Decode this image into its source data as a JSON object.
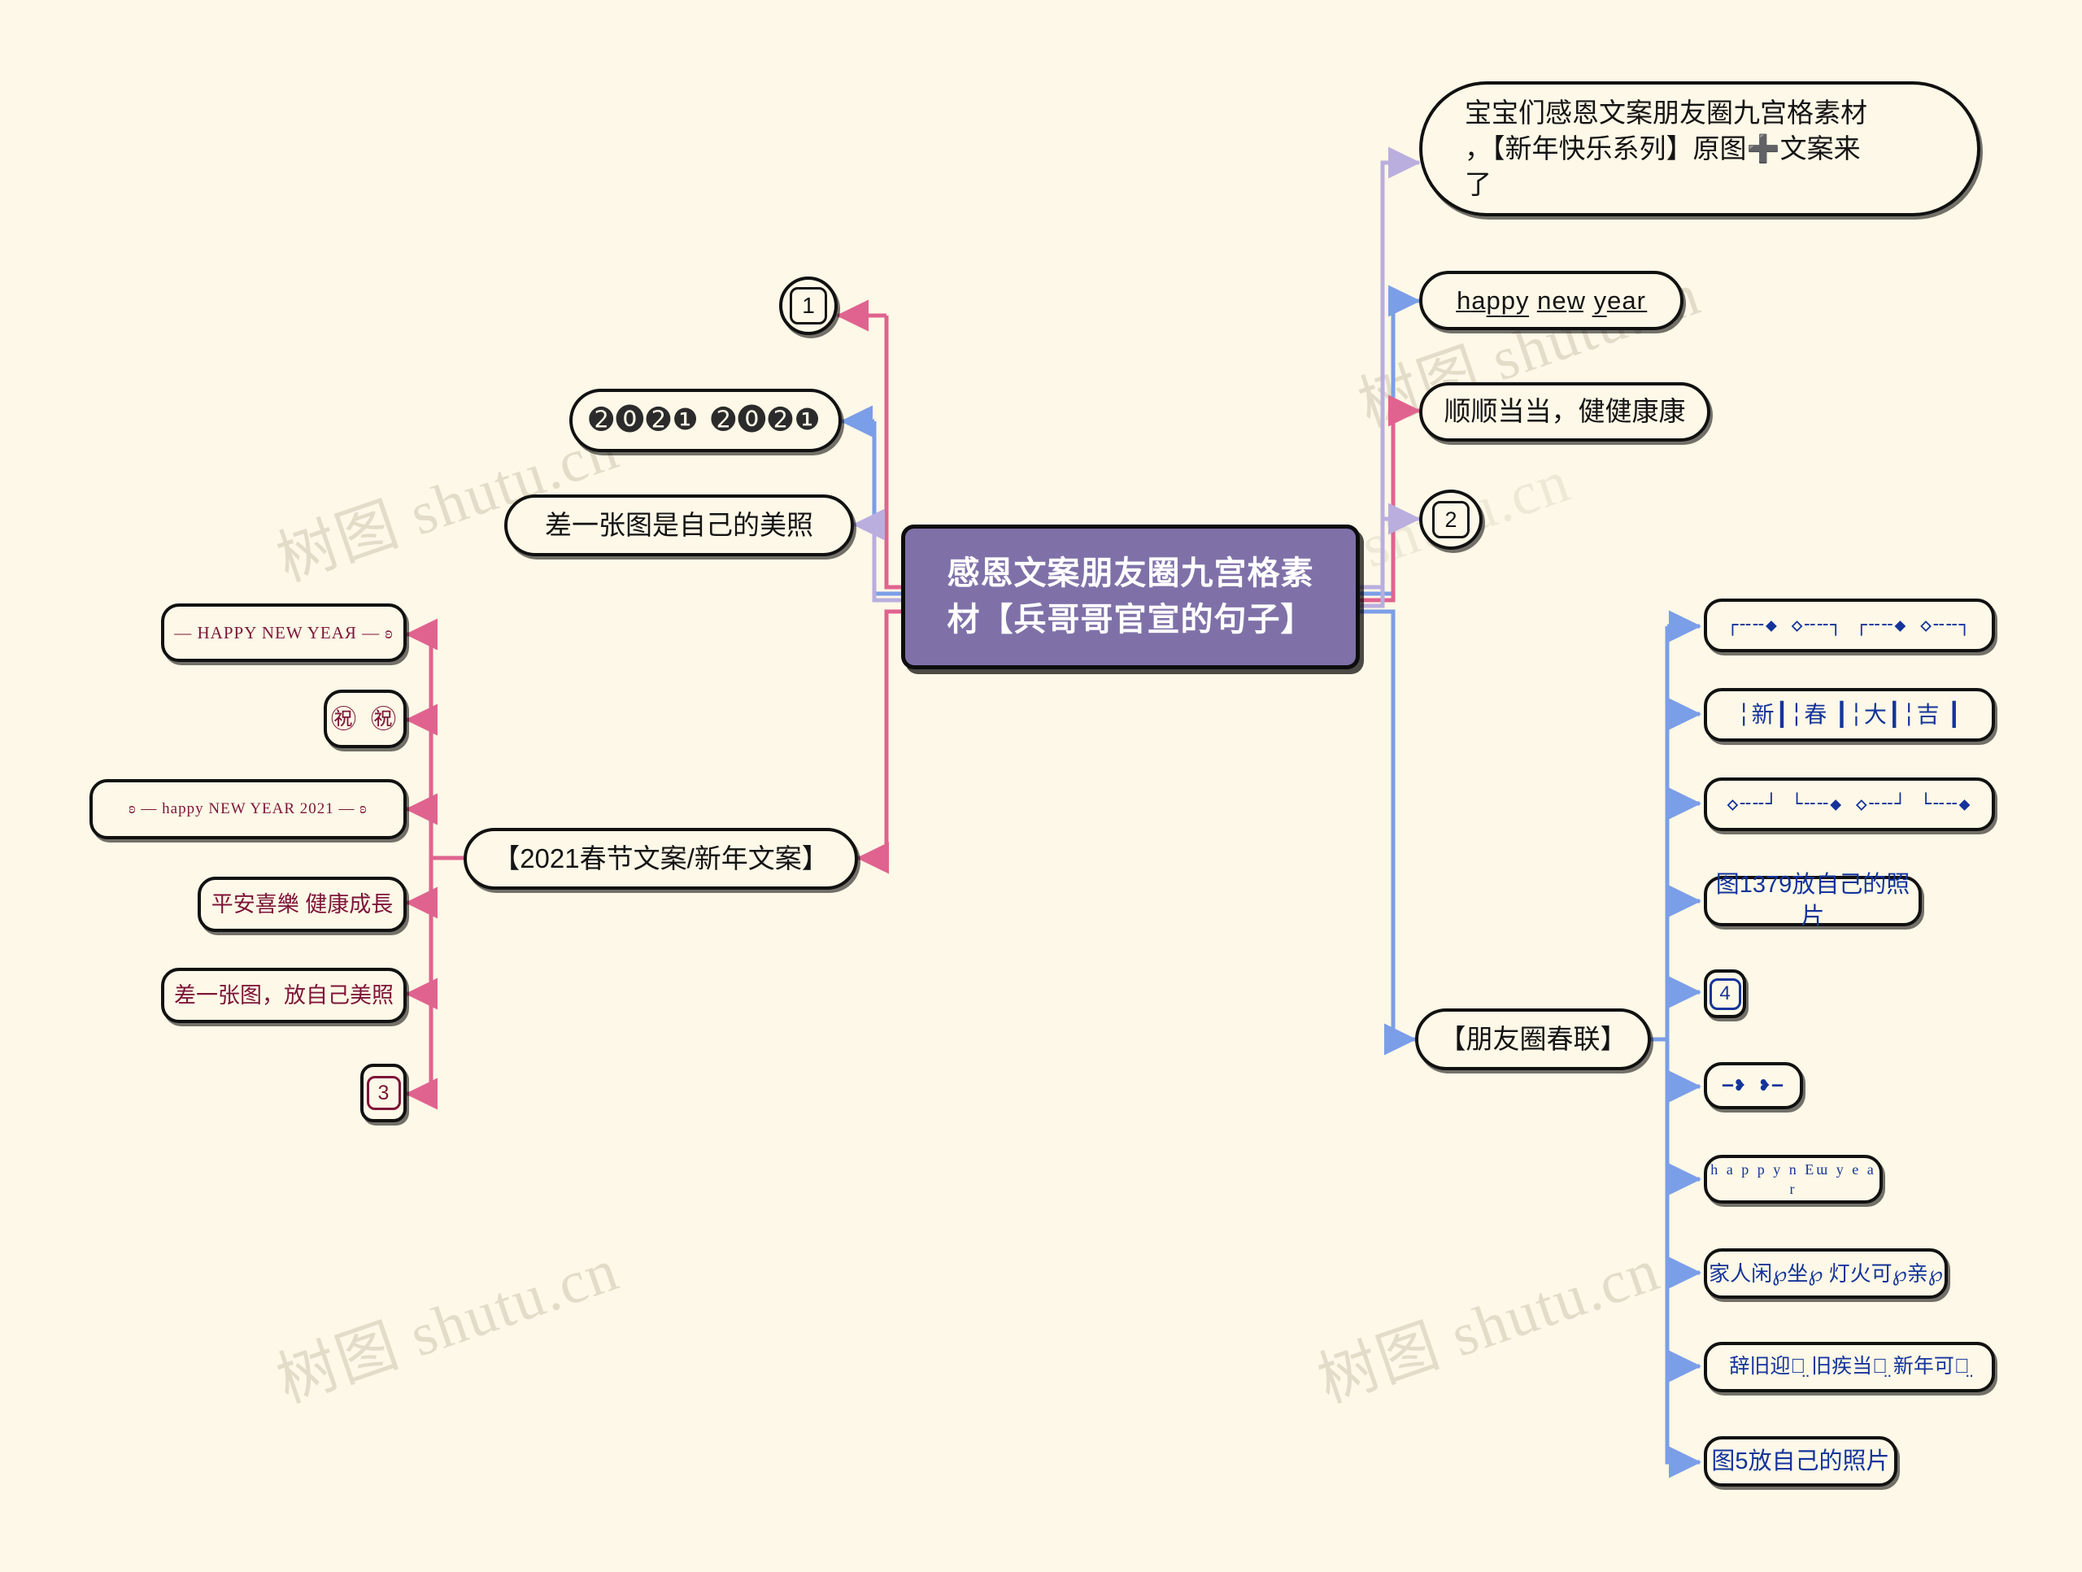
{
  "meta": {
    "background": "#fdf8e7",
    "root_fill": "#7f71a8",
    "link_colors": {
      "pink": "#e0638f",
      "blue": "#7b9ee8",
      "lavender": "#b9aede",
      "maroon": "#7d1538",
      "navy": "#14349b"
    }
  },
  "watermarks": [
    {
      "text": "树图 shutu.cn"
    },
    {
      "text": "树图 shutu.cn"
    },
    {
      "text": "树图 shutu.cn"
    },
    {
      "text": "树图 shutu.cn"
    },
    {
      "text": "树图 shutu.cn"
    }
  ],
  "root": {
    "label": "感恩文案朋友圈九宫格素材【兵哥哥官宣的句子】",
    "line1": "感恩文案朋友圈九宫格素",
    "line2": "材【兵哥哥官宣的句子】"
  },
  "branches": {
    "left_top": {
      "name": "left-upper-branch",
      "nodes": [
        {
          "id": "n-circle-1",
          "label": "1",
          "kind": "circled-number",
          "link": "pink"
        },
        {
          "id": "n-2021",
          "label": "➋⓿➋❶ ➋⓿➋❶",
          "kind": "negative-circled-digits",
          "link": "blue"
        },
        {
          "id": "n-meizhao",
          "label": "差一张图是自己的美照",
          "kind": "text",
          "link": "lavender"
        }
      ]
    },
    "left_bottom": {
      "name": "left-lower-branch",
      "parent": {
        "id": "n-2021-chunjie",
        "label": "【2021春节文案/新年文案】",
        "link": "pink"
      },
      "nodes": [
        {
          "id": "n-hny-1",
          "label": "— HAPPY NEW YEAЯ — ʚ",
          "kind": "decorative",
          "link": "pink"
        },
        {
          "id": "n-zhu",
          "label": "㊗ ㊗",
          "kind": "decorative",
          "link": "pink"
        },
        {
          "id": "n-hny-2021",
          "label": "ʚ — happy NEW YEAR 2021 — ʚ",
          "kind": "decorative",
          "link": "pink"
        },
        {
          "id": "n-pingan",
          "label": "平安喜樂 健康成長",
          "kind": "text",
          "link": "pink"
        },
        {
          "id": "n-chayizhang",
          "label": "差一张图，放自己美照",
          "kind": "text",
          "link": "pink"
        },
        {
          "id": "n-box-3",
          "label": "3",
          "kind": "boxed-number",
          "link": "pink"
        }
      ]
    },
    "right_top": {
      "name": "right-upper-branch",
      "nodes": [
        {
          "id": "n-baobao",
          "label": "宝宝们感恩文案朋友圈九宫格素材，【新年快乐系列】原图➕文案来了",
          "line1": "宝宝们感恩文案朋友圈九宫格素材",
          "line2": "，【新年快乐系列】原图➕文案来",
          "line3": "了",
          "kind": "text",
          "link": "lavender"
        },
        {
          "id": "n-happy-new-year",
          "label": "h̲a̲p̲p̲y̲ n̲e̲w̲ y̲e̲a̲r̲",
          "kind": "decorative",
          "link": "blue"
        },
        {
          "id": "n-shunshun",
          "label": "顺顺当当，健健康康",
          "kind": "text",
          "link": "pink"
        },
        {
          "id": "n-box-2",
          "label": "2",
          "kind": "boxed-number",
          "link": "lavender"
        }
      ]
    },
    "right_bottom": {
      "name": "right-lower-branch",
      "parent": {
        "id": "n-chunlian",
        "label": "【朋友圈春联】",
        "link": "blue"
      },
      "nodes": [
        {
          "id": "n-deco-1",
          "label": "┌╌╌◆ ◇╌╌┐ ┌╌╌◆ ◇╌╌┐",
          "kind": "decorative",
          "link": "blue"
        },
        {
          "id": "n-xinchundaji",
          "label": "╎新┃╎春 ┃╎大┃╎吉 ┃",
          "kind": "decorative",
          "link": "blue"
        },
        {
          "id": "n-deco-2",
          "label": "◇╌╌┘ └╌╌◆ ◇╌╌┘ └╌╌◆",
          "kind": "decorative",
          "link": "blue"
        },
        {
          "id": "n-tu1379",
          "label": "图1379放自己的照片",
          "kind": "text",
          "link": "blue"
        },
        {
          "id": "n-box-4",
          "label": "4",
          "kind": "boxed-number",
          "link": "blue"
        },
        {
          "id": "n-hearts",
          "label": "—❥ ❥—",
          "kind": "decorative",
          "link": "blue"
        },
        {
          "id": "n-happynew",
          "label": "h a p p y n Eɯ y e a r",
          "kind": "decorative",
          "link": "blue"
        },
        {
          "id": "n-jiaren",
          "label": "家人闲℘坐℘ 灯火可℘亲℘",
          "kind": "text",
          "link": "blue"
        },
        {
          "id": "n-ciju",
          "label": "辞旧迎新̤ 旧疾当愈̤ 新年可期̤",
          "kind": "text",
          "link": "blue"
        },
        {
          "id": "n-tu5",
          "label": "图5放自己的照片",
          "kind": "text",
          "link": "blue"
        }
      ]
    }
  }
}
